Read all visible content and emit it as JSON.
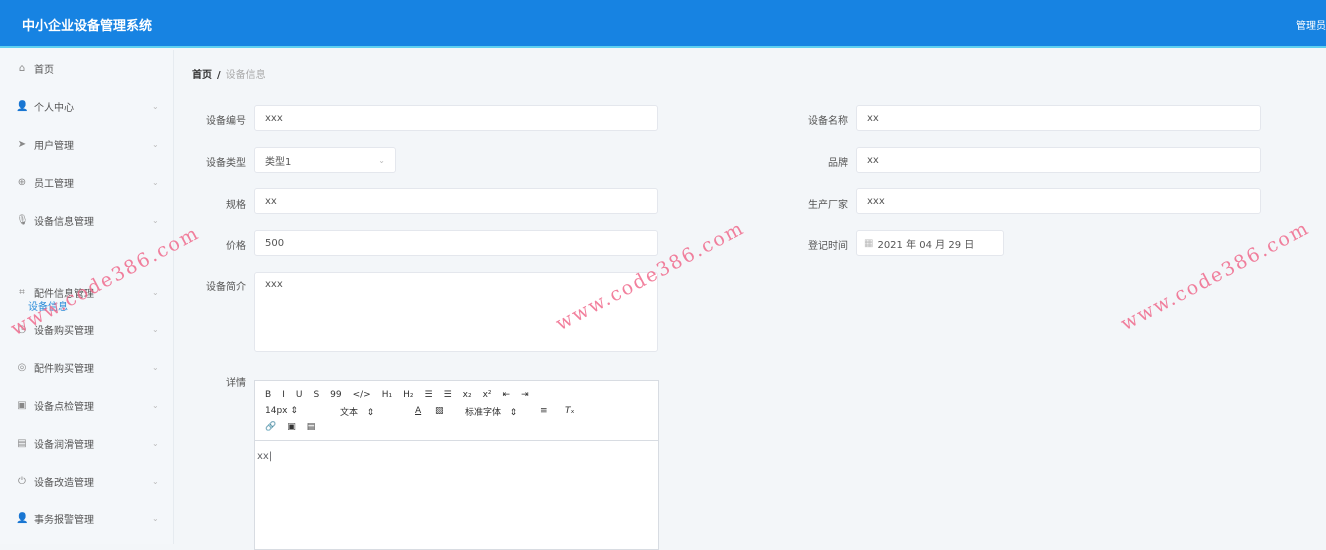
{
  "header": {
    "title": "中小企业设备管理系统",
    "user": "管理员"
  },
  "sidebar": {
    "items": [
      {
        "label": "首页",
        "icon": "home-icon",
        "chev": false
      },
      {
        "label": "个人中心",
        "icon": "user-icon",
        "chev": true
      },
      {
        "label": "用户管理",
        "icon": "send-icon",
        "chev": true
      },
      {
        "label": "员工管理",
        "icon": "compass-icon",
        "chev": true
      },
      {
        "label": "设备信息管理",
        "icon": "microphone-icon",
        "chev": true
      },
      {
        "label": "配件信息管理",
        "icon": "crop-icon",
        "chev": true
      },
      {
        "label": "设备购买管理",
        "icon": "clock-icon",
        "chev": true
      },
      {
        "label": "配件购买管理",
        "icon": "support-icon",
        "chev": true
      },
      {
        "label": "设备点检管理",
        "icon": "clipboard-icon",
        "chev": true
      },
      {
        "label": "设备润滑管理",
        "icon": "chart-icon",
        "chev": true
      },
      {
        "label": "设备改造管理",
        "icon": "power-icon",
        "chev": true
      },
      {
        "label": "事务报警管理",
        "icon": "user-icon",
        "chev": true
      }
    ],
    "sub_item": "设备信息"
  },
  "breadcrumb": {
    "home": "首页",
    "sep": "/",
    "current": "设备信息"
  },
  "form": {
    "code": {
      "label": "设备编号",
      "value": "xxx"
    },
    "name": {
      "label": "设备名称",
      "value": "xx"
    },
    "type": {
      "label": "设备类型",
      "value": "类型1"
    },
    "brand": {
      "label": "品牌",
      "value": "xx"
    },
    "spec": {
      "label": "规格",
      "value": "xx"
    },
    "maker": {
      "label": "生产厂家",
      "value": "xxx"
    },
    "price": {
      "label": "价格",
      "value": "500"
    },
    "date": {
      "label": "登记时间",
      "value": "2021 年 04 月 29 日"
    },
    "intro": {
      "label": "设备简介",
      "value": "xxx"
    },
    "detail": {
      "label": "详情",
      "value": "xx"
    }
  },
  "editor": {
    "row1": [
      "B",
      "I",
      "U",
      "S",
      "99",
      "</>",
      "H₁",
      "H₂",
      "☰",
      "☰",
      "x₂",
      "x²",
      "⇤",
      "⇥"
    ],
    "size": "14px",
    "para": "文本",
    "font": "标准字体",
    "row3": [
      "🔗",
      "▣",
      "▤"
    ]
  },
  "watermark": "www.code386.com"
}
